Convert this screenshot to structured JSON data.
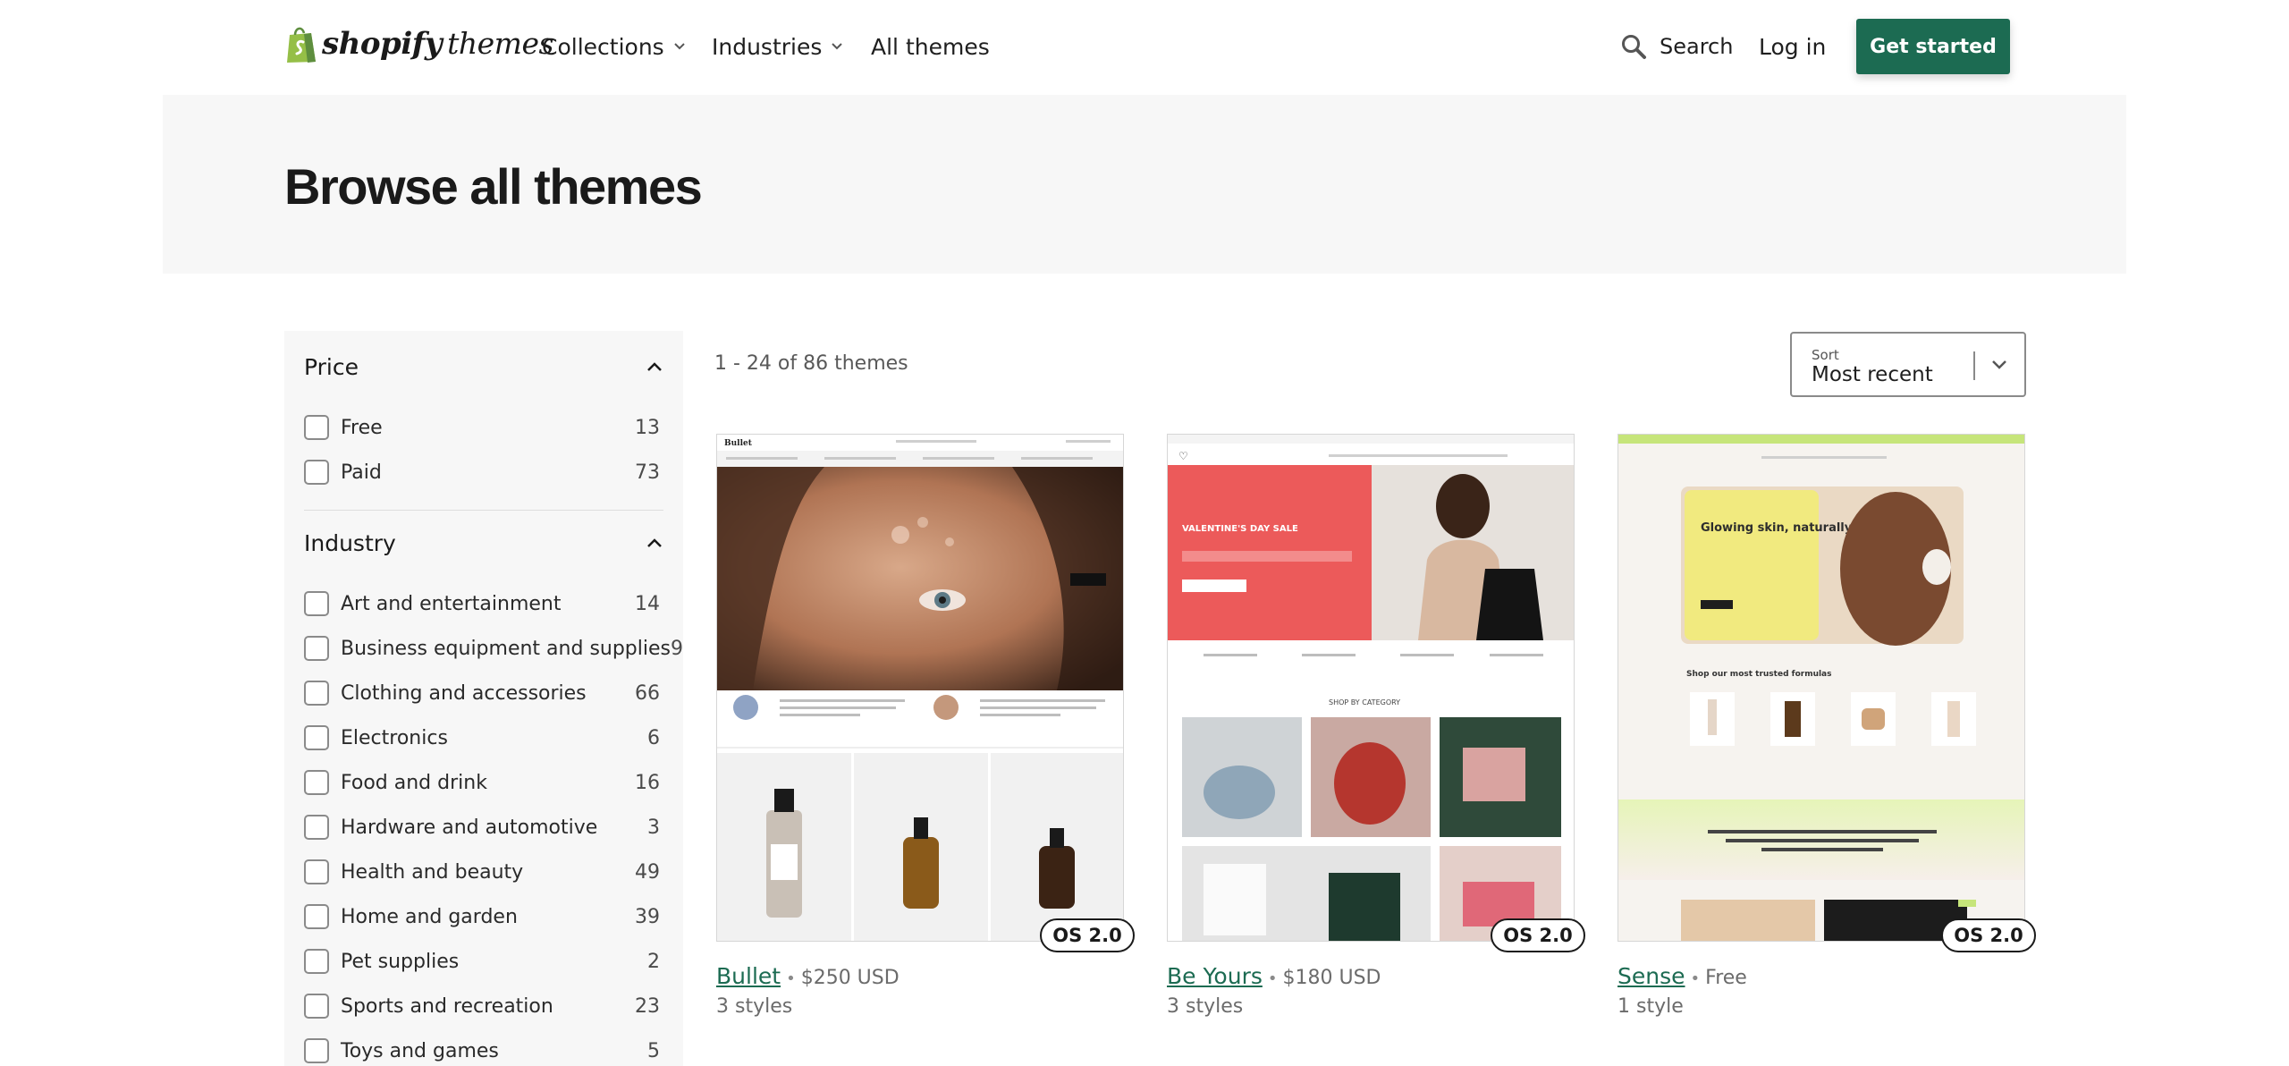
{
  "header": {
    "logo_bold": "shopify",
    "logo_light": "themes",
    "nav": {
      "collections": "Collections",
      "industries": "Industries",
      "all_themes": "All themes"
    },
    "search": "Search",
    "login": "Log in",
    "get_started": "Get started",
    "accent_color": "#1c6b52"
  },
  "hero": {
    "title": "Browse all themes"
  },
  "filters": {
    "price": {
      "title": "Price",
      "options": [
        {
          "label": "Free",
          "count": "13"
        },
        {
          "label": "Paid",
          "count": "73"
        }
      ]
    },
    "industry": {
      "title": "Industry",
      "options": [
        {
          "label": "Art and entertainment",
          "count": "14"
        },
        {
          "label": "Business equipment and supplies",
          "count": "9"
        },
        {
          "label": "Clothing and accessories",
          "count": "66"
        },
        {
          "label": "Electronics",
          "count": "6"
        },
        {
          "label": "Food and drink",
          "count": "16"
        },
        {
          "label": "Hardware and automotive",
          "count": "3"
        },
        {
          "label": "Health and beauty",
          "count": "49"
        },
        {
          "label": "Home and garden",
          "count": "39"
        },
        {
          "label": "Pet supplies",
          "count": "2"
        },
        {
          "label": "Sports and recreation",
          "count": "23"
        },
        {
          "label": "Toys and games",
          "count": "5"
        }
      ]
    }
  },
  "results": {
    "count_text": "1 - 24 of 86 themes",
    "sort_label": "Sort",
    "sort_value": "Most recent"
  },
  "themes": [
    {
      "name": "Bullet",
      "price": "$250 USD",
      "styles": "3 styles",
      "badge": "OS 2.0",
      "brand_text": "Bullet",
      "sale_text": ""
    },
    {
      "name": "Be Yours",
      "price": "$180 USD",
      "styles": "3 styles",
      "badge": "OS 2.0",
      "sale_text": "VALENTINE'S DAY SALE",
      "category_text": "SHOP BY CATEGORY"
    },
    {
      "name": "Sense",
      "price": "Free",
      "styles": "1 style",
      "badge": "OS 2.0",
      "hero_text": "Glowing skin, naturally",
      "section_text": "Shop our most trusted formulas"
    }
  ]
}
